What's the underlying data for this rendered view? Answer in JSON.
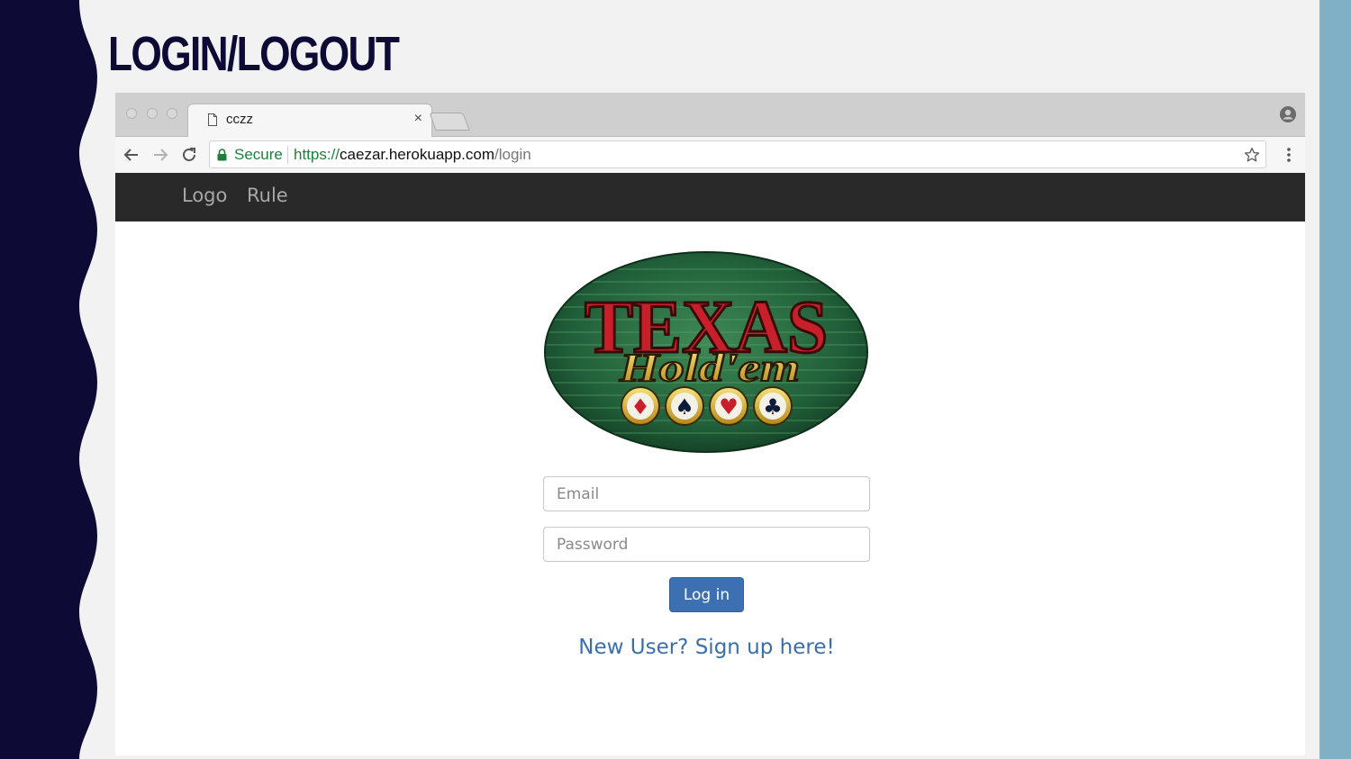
{
  "slide": {
    "title": "LOGIN/LOGOUT"
  },
  "browser": {
    "tab": {
      "title": "cczz",
      "close_glyph": "×",
      "icon": "document-icon"
    },
    "address_bar": {
      "secure_label": "Secure",
      "scheme": "https://",
      "host": "caezar.herokuapp.com",
      "path": "/login"
    }
  },
  "site": {
    "nav": {
      "items": [
        {
          "label": "Logo"
        },
        {
          "label": "Rule"
        }
      ]
    },
    "logo": {
      "line1": "TEXAS",
      "line2": "Hold'em",
      "suits": [
        "♦",
        "♠",
        "♥",
        "♣"
      ]
    },
    "login_form": {
      "email_placeholder": "Email",
      "password_placeholder": "Password",
      "submit_label": "Log in"
    },
    "signup_link": "New User? Sign up here!"
  },
  "colors": {
    "slide_background": "#f2f2f2",
    "left_wave": "#0d0b36",
    "right_bar": "#7fb0c6",
    "navbar": "#292929",
    "login_button": "#3d70b2",
    "link": "#3a6fab",
    "secure_green": "#1e7f3c"
  }
}
